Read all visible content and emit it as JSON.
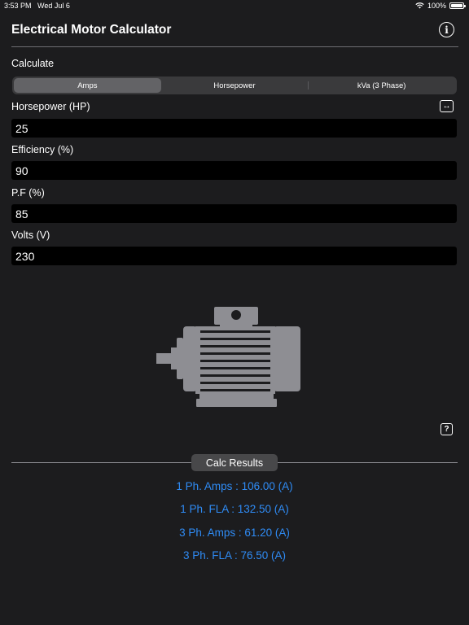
{
  "status": {
    "time": "3:53 PM",
    "date": "Wed Jul 6",
    "battery": "100%"
  },
  "header": {
    "title": "Electrical Motor Calculator"
  },
  "calculate": {
    "label": "Calculate",
    "segments": [
      "Amps",
      "Horsepower",
      "kVa (3 Phase)"
    ],
    "selected": "Amps"
  },
  "fields": [
    {
      "label": "Horsepower (HP)",
      "value": "25"
    },
    {
      "label": "Efficiency (%)",
      "value": "90"
    },
    {
      "label": "P.F (%)",
      "value": "85"
    },
    {
      "label": "Volts (V)",
      "value": "230"
    }
  ],
  "results": {
    "title": "Calc Results",
    "items": [
      "1 Ph. Amps : 106.00 (A)",
      "1 Ph. FLA : 132.50 (A)",
      "3 Ph. Amps : 61.20 (A)",
      "3 Ph. FLA : 76.50 (A)"
    ],
    "color": "#2f8cf6"
  },
  "icons": {
    "info": "info-circle-icon",
    "swap": "swap-arrows-icon",
    "help": "question-square-icon",
    "wifi": "wifi-icon",
    "battery": "battery-icon",
    "motor": "electric-motor-illustration"
  }
}
